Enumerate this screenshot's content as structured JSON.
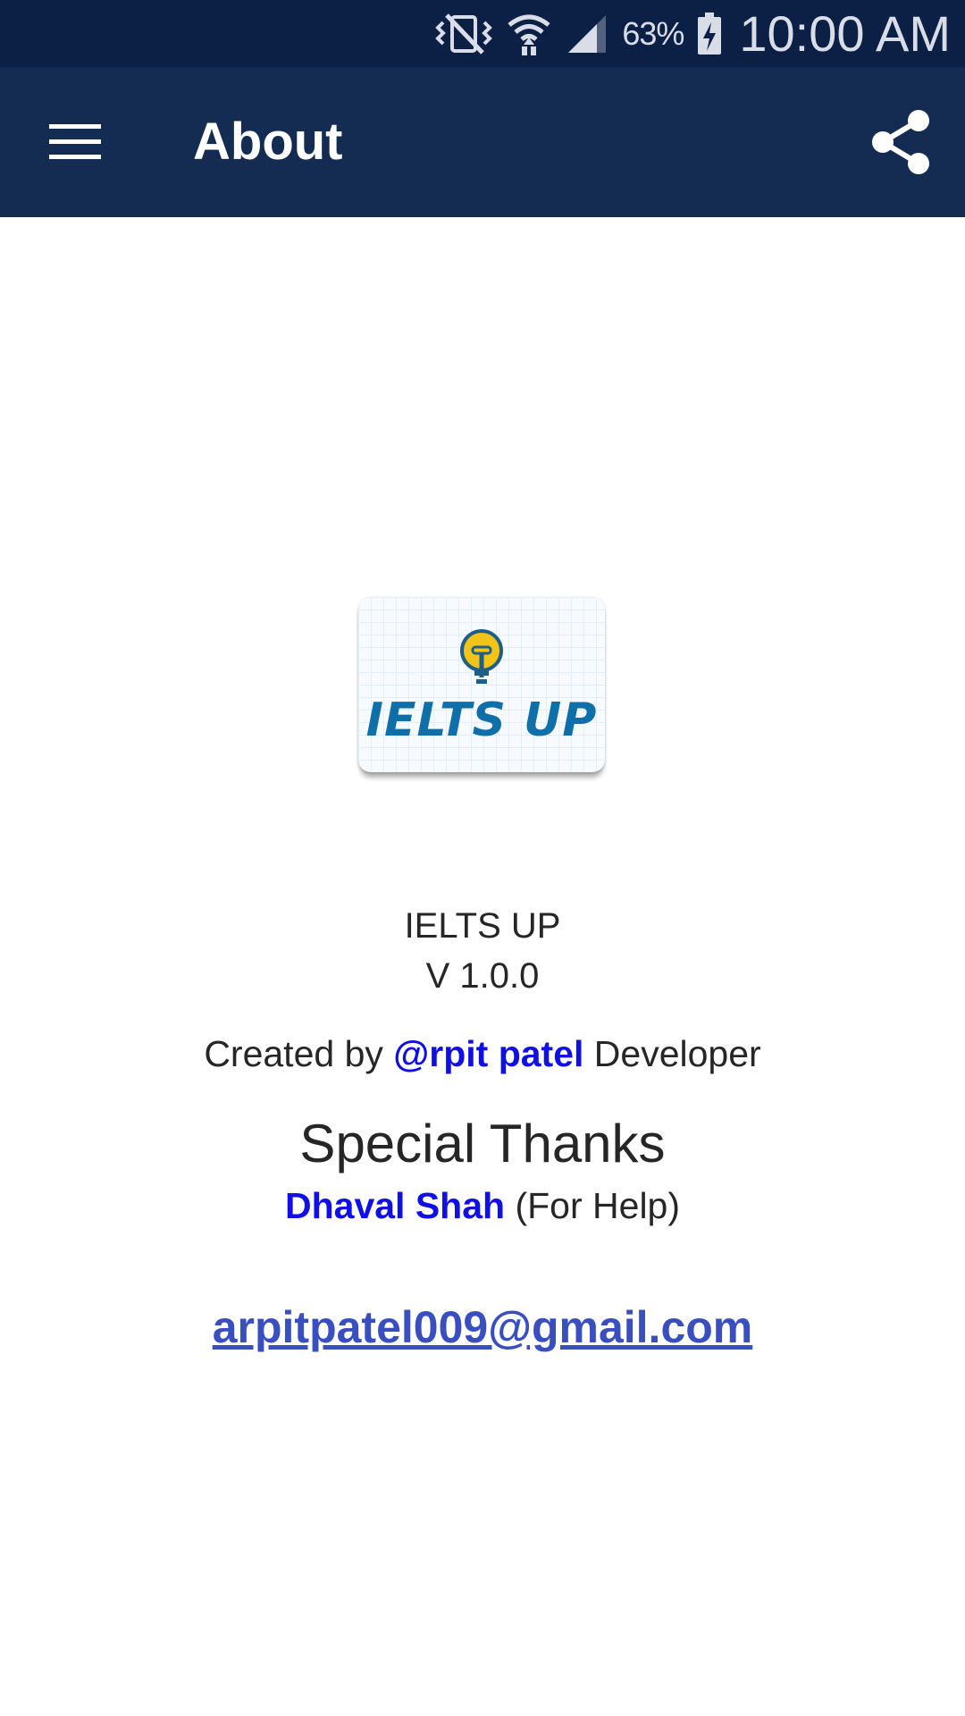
{
  "status_bar": {
    "battery_percent": "63%",
    "time": "10:00 AM"
  },
  "app_bar": {
    "title": "About"
  },
  "logo": {
    "text": "IELTS UP"
  },
  "about": {
    "app_name": "IELTS UP",
    "version": "V 1.0.0",
    "created_prefix": "Created by",
    "creator_name": "@rpit patel",
    "created_suffix": "Developer",
    "special_thanks_title": "Special Thanks",
    "thanks_name": "Dhaval Shah",
    "thanks_note": "(For Help)",
    "email": "arpitpatel009@gmail.com"
  },
  "colors": {
    "status_bar_bg": "#0c1f44",
    "app_bar_bg": "#152c52",
    "link_blue": "#1010e6",
    "email_link": "#3a4fbf",
    "logo_text": "#0f6fa8",
    "bulb_yellow": "#f2c418"
  },
  "icons": {
    "status": [
      "vibrate-icon",
      "wifi-icon",
      "signal-icon",
      "battery-charging-icon"
    ],
    "app_bar": [
      "hamburger-menu-icon",
      "share-icon"
    ],
    "logo": "lightbulb-icon"
  }
}
